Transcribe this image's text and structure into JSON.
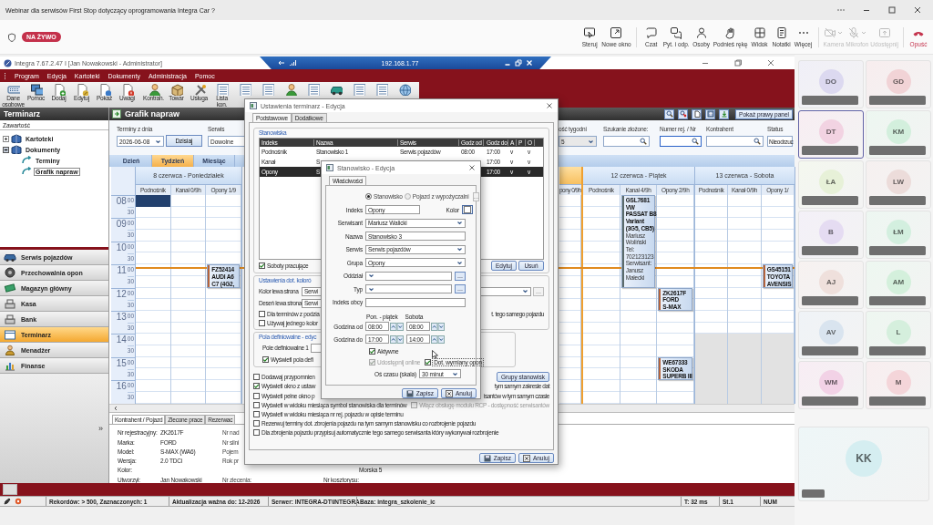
{
  "meeting": {
    "title": "Webinar dla serwisów First Stop dotyczący oprogramowania Integra Car ?",
    "live_badge": "NA ŻYWO",
    "control_groups": [
      {
        "items": [
          {
            "label": "Steruj",
            "kind": "button",
            "disabled": false,
            "dropdown": false
          },
          {
            "label": "Nowe okno",
            "kind": "button",
            "disabled": false,
            "dropdown": false
          }
        ]
      },
      {
        "items": [
          {
            "label": "Czat",
            "kind": "button",
            "disabled": false,
            "dropdown": false
          },
          {
            "label": "Pyt. i odp.",
            "kind": "button",
            "disabled": false,
            "dropdown": false
          },
          {
            "label": "Osoby",
            "kind": "button",
            "disabled": false,
            "dropdown": false
          },
          {
            "label": "Podnieś rękę",
            "kind": "button",
            "disabled": false,
            "dropdown": false
          },
          {
            "label": "Widok",
            "kind": "button",
            "disabled": false,
            "dropdown": false
          },
          {
            "label": "Notatki",
            "kind": "button",
            "disabled": false,
            "dropdown": false
          },
          {
            "label": "Więcej",
            "kind": "button",
            "disabled": false,
            "dropdown": false
          }
        ]
      },
      {
        "items": [
          {
            "label": "Kamera",
            "kind": "button",
            "disabled": true,
            "dropdown": true
          },
          {
            "label": "Mikrofon",
            "kind": "button",
            "disabled": true,
            "dropdown": true
          },
          {
            "label": "Udostępnij",
            "kind": "button",
            "disabled": true,
            "dropdown": false
          }
        ]
      },
      {
        "items": [
          {
            "label": "Opuść",
            "kind": "leave",
            "disabled": false,
            "dropdown": false
          }
        ]
      }
    ]
  },
  "integra": {
    "title": "Integra 7.67.2.47 I [Jan Nowakowski - Administrator]",
    "remote_host": "192.168.1.77",
    "menu": [
      "Program",
      "Edycja",
      "Kartoteki",
      "Dokumenty",
      "Administracja",
      "Pomoc"
    ],
    "toolbar": [
      {
        "label": "Dane osobowe"
      },
      {
        "label": "Pomoc"
      },
      {
        "label": "Dodaj"
      },
      {
        "label": "Edytuj"
      },
      {
        "label": "Pokaż"
      },
      {
        "label": "Uwagi"
      },
      {
        "label": "Kontrah."
      },
      {
        "label": "Towar"
      },
      {
        "label": "Usługa"
      },
      {
        "label": "Lista kon."
      }
    ],
    "sidebar": {
      "title": "Terminarz",
      "subtitle": "Zawartość",
      "tree": [
        {
          "label": "Kartoteki",
          "expanded": false,
          "selected": false
        },
        {
          "label": "Dokumenty",
          "expanded": true,
          "selected": false,
          "children": [
            {
              "label": "Terminy",
              "selected": false
            },
            {
              "label": "Grafik napraw",
              "selected": true
            }
          ]
        }
      ],
      "modules": [
        {
          "label": "Serwis pojazdów",
          "selected": false
        },
        {
          "label": "Przechowalnia opon",
          "selected": false
        },
        {
          "label": "Magazyn główny",
          "selected": false
        },
        {
          "label": "Kasa",
          "selected": false
        },
        {
          "label": "Bank",
          "selected": false
        },
        {
          "label": "Terminarz",
          "selected": true
        },
        {
          "label": "Menadżer",
          "selected": false
        },
        {
          "label": "Finanse",
          "selected": false
        }
      ],
      "more": "»"
    },
    "view": {
      "title": "Grafik napraw",
      "panel_button": "Pokaż prawy panel",
      "filters": [
        {
          "kind": "date",
          "label": "Terminy z dnia",
          "value": "2026-06-08"
        },
        {
          "kind": "button",
          "label": "Dzisiaj"
        },
        {
          "kind": "select",
          "label": "Serwis",
          "value": "Dowolne",
          "disabled": false
        },
        {
          "kind": "select",
          "label": "ość tygodni",
          "value": "5",
          "disabled": true
        },
        {
          "kind": "search",
          "label": "Szukanie złożone:",
          "focused": false
        },
        {
          "kind": "search",
          "label": "Numer rej. / Nr",
          "focused": true
        },
        {
          "kind": "search",
          "label": "Kontrahent",
          "focused": false
        },
        {
          "kind": "select",
          "label": "Status",
          "value": "Nieodrzuc",
          "disabled": false
        }
      ],
      "tabs": [
        {
          "label": "Dzień",
          "selected": false
        },
        {
          "label": "Tydzień",
          "selected": true
        },
        {
          "label": "Miesiąc",
          "selected": false
        }
      ],
      "calendar": {
        "hours": [
          {
            "hour": "08",
            "minutes": [
              "00",
              "30"
            ]
          },
          {
            "hour": "09",
            "minutes": [
              "00",
              "30"
            ]
          },
          {
            "hour": "10",
            "minutes": [
              "00",
              "30"
            ]
          },
          {
            "hour": "11",
            "minutes": [
              "00",
              "30"
            ]
          },
          {
            "hour": "12",
            "minutes": [
              "00",
              "30"
            ]
          },
          {
            "hour": "13",
            "minutes": [
              "00",
              "30"
            ]
          },
          {
            "hour": "14",
            "minutes": [
              "00",
              "30"
            ]
          },
          {
            "hour": "15",
            "minutes": [
              "00",
              "30"
            ]
          },
          {
            "hour": "16",
            "minutes": [
              "00",
              "30"
            ]
          }
        ],
        "days": [
          {
            "title": "8 czerwca - Poniedziałek",
            "highlighted": false,
            "short_day": false,
            "columns": [
              {
                "label": "Podnośnik",
                "selected": true
              },
              {
                "label": "Kanał 0/9h",
                "selected": false
              },
              {
                "label": "Opony 1/9",
                "selected": false,
                "events": [
                  {
                    "color": "#b4643c",
                    "title": [
                      "FZ52414",
                      "AUDI A6",
                      "C7 (4G2,"
                    ]
                  }
                ]
              }
            ]
          },
          {
            "highlighted": true,
            "short_day": false,
            "columns": [
              {
                "label": "pony 0/9h",
                "selected": false
              }
            ]
          },
          {
            "title": "12 czerwca - Piątek",
            "highlighted": false,
            "short_day": false,
            "columns": [
              {
                "label": "Podnośnik",
                "selected": false
              },
              {
                "label": "Kanał 4/9h",
                "selected": false,
                "events": [
                  {
                    "color": "#5c6b6b",
                    "title": [
                      "GSL7681",
                      "VW",
                      "PASSAT B8",
                      "Variant",
                      "(3G5, CB5)"
                    ],
                    "details": [
                      "Mariusz",
                      "Woliński",
                      "Tel:",
                      "702123123",
                      "Serwisant:",
                      "Janusz",
                      "Małecki"
                    ]
                  }
                ]
              },
              {
                "label": "Opony 2/9h",
                "selected": false,
                "events": [
                  {
                    "color": "#b4643c",
                    "title": [
                      "ZK2617F",
                      "FORD",
                      "S-MAX"
                    ]
                  },
                  {
                    "color": "#b4643c",
                    "title": [
                      "WE67333",
                      "SKODA",
                      "SUPERB III"
                    ]
                  }
                ]
              }
            ]
          },
          {
            "title": "13 czerwca - Sobota",
            "highlighted": false,
            "short_day": true,
            "columns": [
              {
                "label": "Podnośnik",
                "selected": false
              },
              {
                "label": "Kanał 0/9h",
                "selected": false
              },
              {
                "label": "Opony 1/",
                "selected": false,
                "events": [
                  {
                    "color": "#b4643c",
                    "title": [
                      "GS45151",
                      "TOYOTA",
                      "AVENSIS"
                    ]
                  }
                ]
              }
            ]
          }
        ]
      },
      "details": {
        "tabs": [
          {
            "label": "Kontrahent / Pojazd",
            "selected": true
          },
          {
            "label": "Zlecone prace",
            "selected": false
          },
          {
            "label": "Rezerwac",
            "selected": false
          }
        ],
        "rows": [
          {
            "label": "Nr rejestracyjny:",
            "value": "ZK2617F",
            "label2": "Nr nad"
          },
          {
            "label": "Marka:",
            "value": "FORD",
            "label2": "Nr silni"
          },
          {
            "label": "Model:",
            "value": "S-MAX (WA6)",
            "label2": "Pojem"
          },
          {
            "label": "Wersja:",
            "value": "2.0 TDCi",
            "label2": "Rok pr"
          },
          {
            "label": "Kolor:",
            "value3": "Morska 5"
          },
          {
            "label": "Utworzył:",
            "value": "Jan Nowakowski",
            "label2": "Nr zlecenia:",
            "label3": "Nr kosztorysu:"
          }
        ]
      }
    },
    "status_bar": [
      {
        "text": "Rekordów: > 500, Zaznaczonych: 1"
      },
      {
        "text": "Aktualizacja ważna do: 12-2026"
      },
      {
        "text": "Serwer: INTEGRA-DT\\INTEGRA"
      },
      {
        "text": "Baza: integra_szkolenie_ic"
      },
      {
        "text": "T: 32 ms"
      },
      {
        "text": "St.1"
      },
      {
        "text": "NUM"
      }
    ]
  },
  "settings_dialog": {
    "title": "Ustawienia terminarz - Edycja",
    "tabs": [
      {
        "label": "Podstawowe",
        "selected": true
      },
      {
        "label": "Dodatkowe",
        "selected": false
      }
    ],
    "stations": {
      "legend": "Stanowiska",
      "columns": [
        "Indeks",
        "Nazwa",
        "Serwis",
        "Godz od",
        "Godz do",
        "A",
        "P",
        "O"
      ],
      "rows": [
        {
          "indeks": "Podnośnik",
          "nazwa": "Stanowisko 1",
          "serwis": "Serwis pojazdów",
          "godz_od": "08:00",
          "godz_do": "17:00",
          "a": "v",
          "o": "v",
          "selected": false
        },
        {
          "indeks": "Kanał",
          "nazwa": "S",
          "godz_do": "17:00",
          "a": "v",
          "o": "v",
          "selected": false
        },
        {
          "indeks": "Opony",
          "nazwa": "S",
          "godz_do": "17:00",
          "a": "v",
          "o": "v",
          "selected": true
        }
      ],
      "saturdays": {
        "label": "Soboty pracujące",
        "checked": true
      },
      "buttons": [
        "Edytuj",
        "Usuń"
      ]
    },
    "colors": {
      "legend": "Ustawienia dot. koloró",
      "fields": [
        {
          "label": "Kolor lewa strona",
          "value": "Serwi"
        },
        {
          "label": "Deseń lewa strona",
          "value": "Serwi"
        }
      ],
      "more_button": "...",
      "options": [
        {
          "label": "Dla terminów z podzia",
          "note": "t. tego samego pojazdu",
          "checked": false
        },
        {
          "label": "Używaj jednego kolor",
          "checked": false
        }
      ]
    },
    "custom_fields": {
      "legend": "Pola definiowalne - edyc",
      "field_label": "Pole definiowalne 1",
      "option": {
        "label": "Wyświetl pola defi",
        "checked": true
      }
    },
    "groups_button": "Grupy stanowisk",
    "options": [
      {
        "label": "Dodawaj przypomnien",
        "checked": false
      },
      {
        "label": "Wyświetl okno z ustaw",
        "note": "tym samym zakresie dat",
        "checked": true
      },
      {
        "label": "Wyświetl pełne okno p",
        "note": "isantów w tym samym czasie",
        "checked": false
      },
      {
        "label": "Wyświetl w widoku miesiąca symbol stanowiska dla terminów",
        "checked": false
      },
      {
        "label": "Wyświetl w widoku miesiąca nr rej. pojazdu w opisie terminu",
        "checked": false
      },
      {
        "label": "Rezerwuj terminy dot. zbrojenia pojazdu na tym samym stanowisku co rozbrojenie pojazdu",
        "checked": false
      },
      {
        "label": "Dla zbrojenia pojazdu przypisuj automatycznie tego samego serwisanta który wykonywał rozbrojenie",
        "checked": false
      }
    ],
    "rcp_option": {
      "label": "Włącz obsługę modułu RCP - dostępność serwisantów",
      "checked": false,
      "disabled": true
    },
    "buttons": [
      "Zapisz",
      "Anuluj"
    ]
  },
  "station_dialog": {
    "title": "Stanowisko - Edycja",
    "tabs": [
      {
        "label": "Właściwości",
        "selected": true
      }
    ],
    "type_options": [
      {
        "label": "Stanowisko",
        "selected": true
      },
      {
        "label": "Pojazd z wypożyczalni",
        "selected": false
      }
    ],
    "type_button": "...",
    "fields": [
      {
        "kind": "text",
        "label": "Indeks",
        "value": "Opony",
        "color_label": "Kolor"
      },
      {
        "kind": "select",
        "label": "Serwisant",
        "value": "Mariusz Walicki"
      },
      {
        "kind": "text",
        "label": "Nazwa",
        "value": "Stanowisko 3"
      },
      {
        "kind": "select",
        "label": "Serwis",
        "value": "Serwis pojazdów"
      },
      {
        "kind": "select",
        "label": "Grupa",
        "value": "Opony"
      },
      {
        "kind": "select_more",
        "label": "Oddział",
        "button": "..."
      },
      {
        "kind": "select_more",
        "label": "Typ",
        "button": "..."
      },
      {
        "kind": "text",
        "label": "Indeks obcy"
      }
    ],
    "hour_headers": [
      "Pon. - piątek",
      "Sobota"
    ],
    "hours": [
      {
        "label": "Godzina od",
        "values": [
          "08:00",
          "08:00"
        ]
      },
      {
        "label": "Godzina do",
        "values": [
          "17:00",
          "14:00"
        ]
      }
    ],
    "active": {
      "label": "Aktywne",
      "checked": true,
      "disabled": false
    },
    "flags": [
      {
        "label": "Udostępnij online",
        "checked": true,
        "disabled": true
      },
      {
        "label": "Dot. wymiany opon",
        "checked": true,
        "disabled": false
      }
    ],
    "scale": {
      "label": "Oś czasu (skala)",
      "value": "30 minut"
    },
    "buttons": [
      "Zapisz",
      "Anuluj"
    ]
  },
  "participants": {
    "tiles": [
      {
        "initials": "DO",
        "color": "#dcd9f0",
        "highlighted": false
      },
      {
        "initials": "GD",
        "color": "#f1d3d6",
        "highlighted": false
      },
      {
        "initials": "DT",
        "color": "#f2d3e2",
        "highlighted": true
      },
      {
        "initials": "KM",
        "color": "#d3efdd",
        "highlighted": false
      },
      {
        "initials": "ŁA",
        "color": "#e7f1d8",
        "highlighted": false
      },
      {
        "initials": "LW",
        "color": "#ecdcda",
        "highlighted": false
      },
      {
        "initials": "B",
        "color": "#e5dcf2",
        "highlighted": false
      },
      {
        "initials": "ŁM",
        "color": "#d3efdf",
        "highlighted": false
      },
      {
        "initials": "AJ",
        "color": "#efe0dc",
        "highlighted": false
      },
      {
        "initials": "AM",
        "color": "#d4f0dc",
        "highlighted": false
      },
      {
        "initials": "AV",
        "color": "#d9e4ef",
        "highlighted": false
      },
      {
        "initials": "L",
        "color": "#d5efdd",
        "highlighted": false
      },
      {
        "initials": "WM",
        "color": "#f2d2e6",
        "highlighted": false
      },
      {
        "initials": "M",
        "color": "#f4d5d9",
        "highlighted": false
      }
    ],
    "self": {
      "initials": "KK",
      "color": "#d5eef1",
      "highlighted": false
    }
  }
}
